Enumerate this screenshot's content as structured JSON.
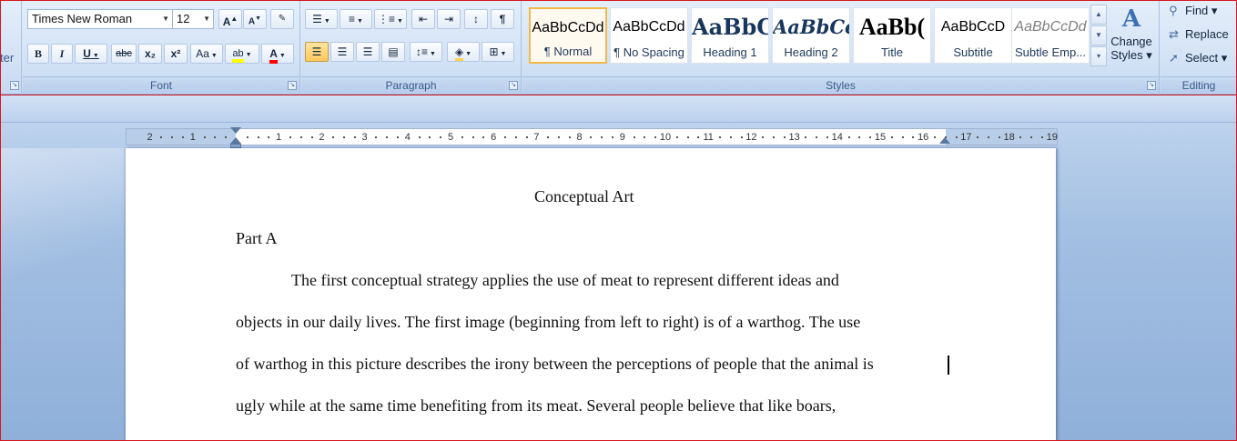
{
  "ribbon": {
    "clipboard_fragment": "ter",
    "font": {
      "label": "Font",
      "family": "Times New Roman",
      "size": "12",
      "grow_label": "A",
      "shrink_label": "A",
      "bold": "B",
      "italic": "I",
      "underline": "U",
      "strike": "abc",
      "subscript": "x₂",
      "superscript": "x²",
      "change_case": "Aa",
      "highlight": "ab",
      "font_color": "A"
    },
    "paragraph": {
      "label": "Paragraph"
    },
    "styles": {
      "label": "Styles",
      "items": [
        {
          "sample": "AaBbCcDd",
          "name": "¶ Normal"
        },
        {
          "sample": "AaBbCcDd",
          "name": "¶ No Spacing"
        },
        {
          "sample": "AaBbC",
          "name": "Heading 1"
        },
        {
          "sample": "AaBbCc",
          "name": "Heading 2"
        },
        {
          "sample": "AaBb(",
          "name": "Title"
        },
        {
          "sample": "AaBbCcD",
          "name": "Subtitle"
        },
        {
          "sample": "AaBbCcDd",
          "name": "Subtle Emp..."
        }
      ],
      "change_styles_line1": "Change",
      "change_styles_line2": "Styles ▾"
    },
    "editing": {
      "label": "Editing",
      "find": "Find ▾",
      "replace": "Replace",
      "select": "Select ▾"
    }
  },
  "ruler": {
    "left_numbers": [
      "2",
      "1"
    ],
    "right_numbers": [
      "1",
      "2",
      "3",
      "4",
      "5",
      "6",
      "7",
      "8",
      "9",
      "10",
      "11",
      "12",
      "13",
      "14",
      "15",
      "16",
      "17",
      "18",
      "19"
    ]
  },
  "document": {
    "title": "Conceptual Art",
    "heading": "Part A",
    "lines": [
      "The first conceptual strategy applies the use of meat to represent different ideas and",
      "objects in our daily lives. The first image (beginning from left to right) is of a warthog. The use",
      "of warthog in this picture describes the irony between the perceptions of people that the animal is",
      "ugly while at the same time benefiting from its meat. Several people believe that like boars,"
    ]
  },
  "colors": {
    "accent": "#f1b94b",
    "highlight": "#ffff00",
    "font_color": "#ff0000",
    "frame": "#d8161f"
  }
}
